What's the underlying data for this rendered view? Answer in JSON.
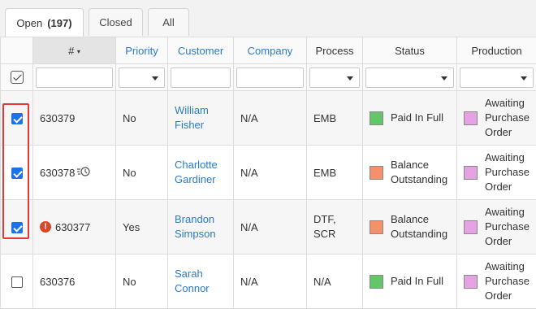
{
  "tabs": [
    {
      "label": "Open",
      "count": "(197)"
    },
    {
      "label": "Closed"
    },
    {
      "label": "All"
    }
  ],
  "columns": {
    "num": "#",
    "priority": "Priority",
    "customer": "Customer",
    "company": "Company",
    "process": "Process",
    "status": "Status",
    "production": "Production"
  },
  "colors": {
    "paid": "#63c76a",
    "balance": "#f4906a",
    "awaiting": "#e6a3e3",
    "link": "#2b7bc9",
    "checkbox": "#1a73e8",
    "highlight": "#e53935"
  },
  "rows": [
    {
      "id": "630379",
      "priority": "No",
      "customer_first": "William",
      "customer_last": "Fisher",
      "company": "N/A",
      "process_1": "EMB",
      "process_2": "",
      "status_1": "Paid In Full",
      "status_2": "",
      "production_1": "Awaiting",
      "production_2": "Purchase",
      "production_3": "Order"
    },
    {
      "id": "630378",
      "priority": "No",
      "customer_first": "Charlotte",
      "customer_last": "Gardiner",
      "company": "N/A",
      "process_1": "EMB",
      "process_2": "",
      "status_1": "Balance",
      "status_2": "Outstanding",
      "production_1": "Awaiting",
      "production_2": "Purchase",
      "production_3": "Order"
    },
    {
      "id": "630377",
      "priority": "Yes",
      "customer_first": "Brandon",
      "customer_last": "Simpson",
      "company": "N/A",
      "process_1": "DTF,",
      "process_2": "SCR",
      "status_1": "Balance",
      "status_2": "Outstanding",
      "production_1": "Awaiting",
      "production_2": "Purchase",
      "production_3": "Order"
    },
    {
      "id": "630376",
      "priority": "No",
      "customer_first": "Sarah",
      "customer_last": "Connor",
      "company": "N/A",
      "process_1": "N/A",
      "process_2": "",
      "status_1": "Paid In Full",
      "status_2": "",
      "production_1": "Awaiting",
      "production_2": "Purchase",
      "production_3": "Order"
    }
  ]
}
